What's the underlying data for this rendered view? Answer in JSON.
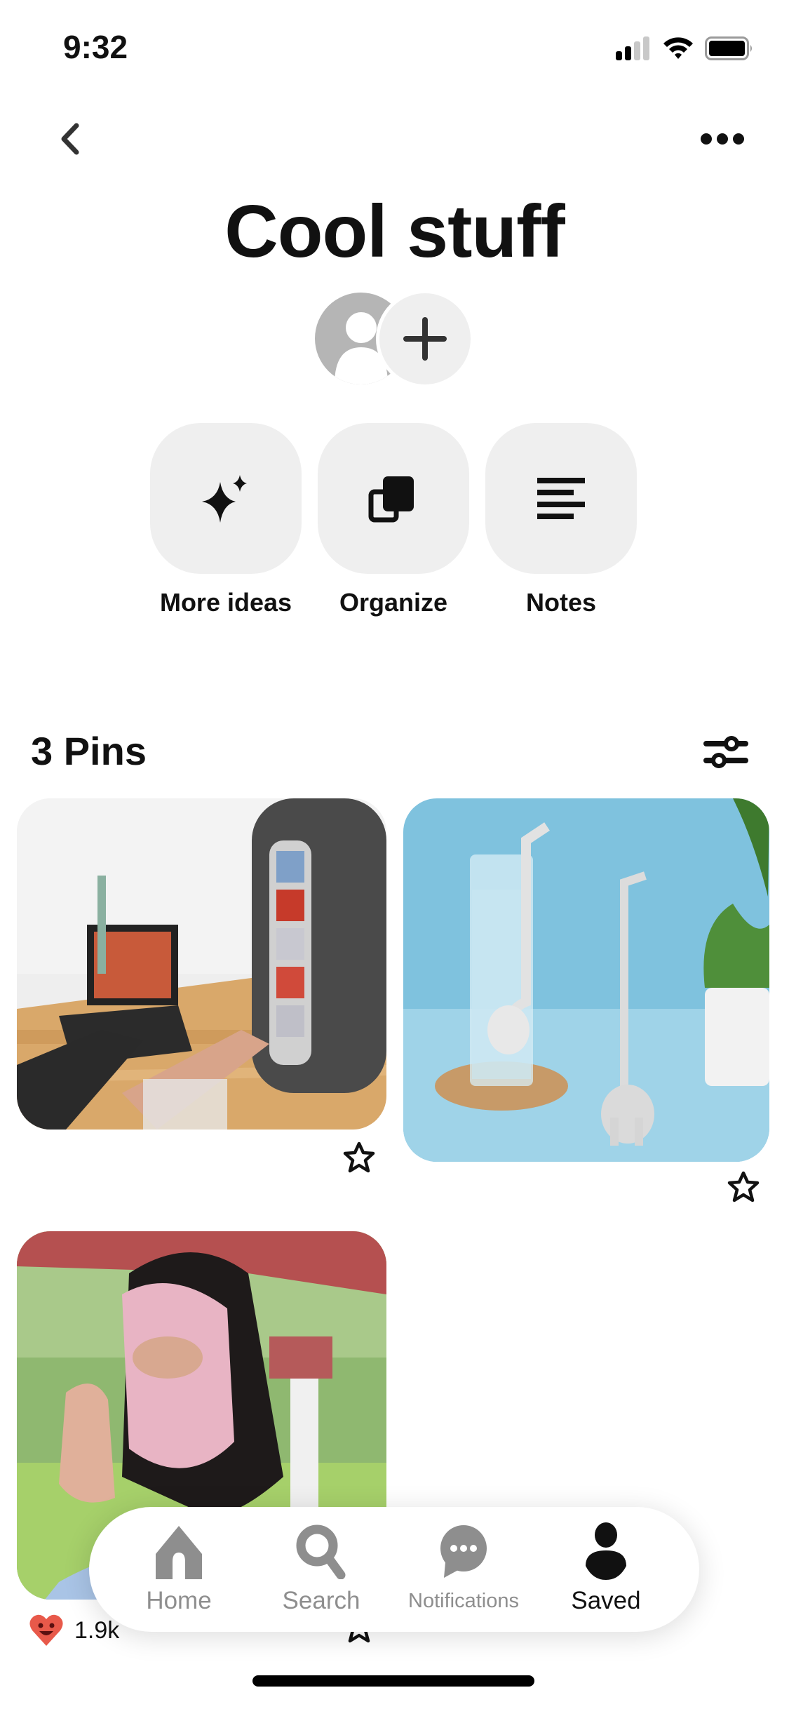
{
  "status_bar": {
    "time": "9:32",
    "signal_bars_active": 2,
    "signal_bars_total": 4,
    "wifi": "wifi-icon",
    "battery": "battery-full-icon"
  },
  "header": {
    "back_icon": "chevron-left-icon",
    "more_icon": "ellipsis-icon",
    "title": "Cool stuff"
  },
  "collaborators": {
    "avatar_icon": "default-user-avatar",
    "add_icon": "plus-icon"
  },
  "actions": [
    {
      "label": "More ideas",
      "icon": "sparkles-icon"
    },
    {
      "label": "Organize",
      "icon": "organize-icon"
    },
    {
      "label": "Notes",
      "icon": "notes-icon"
    }
  ],
  "pins_section": {
    "count_label": "3 Pins",
    "filter_icon": "filter-sliders-icon"
  },
  "pins": [
    {
      "description": "Mini vending machine fridge on desk next to laptop",
      "saved_icon": "star-outline-icon"
    },
    {
      "description": "Elephant straw in glass of water on blue background",
      "saved_icon": "star-outline-icon"
    },
    {
      "description": "Woman wearing pink full face mask outdoors",
      "reaction_icon": "heart-smile-icon",
      "reaction_count": "1.9k",
      "saved_icon": "star-outline-icon"
    }
  ],
  "bottom_nav": {
    "items": [
      {
        "label": "Home",
        "icon": "home-icon",
        "active": false
      },
      {
        "label": "Search",
        "icon": "search-icon",
        "active": false
      },
      {
        "label": "Notifications",
        "icon": "chat-bubble-icon",
        "active": false
      },
      {
        "label": "Saved",
        "icon": "person-icon",
        "active": true
      }
    ]
  },
  "colors": {
    "text": "#111111",
    "inactive": "#8e8e8e",
    "button_bg": "#efefef",
    "heart": "#e8594a"
  }
}
